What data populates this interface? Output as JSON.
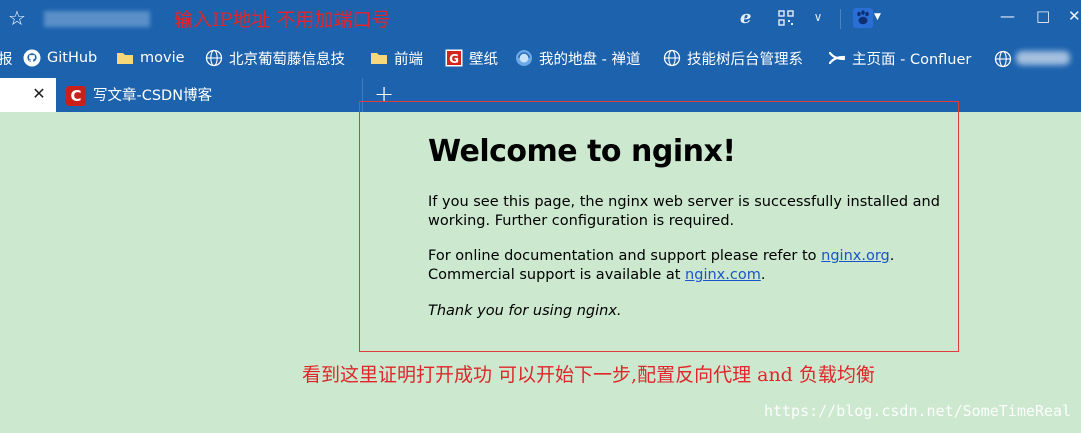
{
  "address_bar": {
    "annotation": "输入IP地址 不用加端口号",
    "icons": [
      "star-icon",
      "ie-icon",
      "qr-code-icon",
      "chevron-down-icon",
      "baidu-paw-icon"
    ]
  },
  "bookmarks": [
    {
      "label": "报",
      "icon": "none"
    },
    {
      "label": "GitHub",
      "icon": "github-icon"
    },
    {
      "label": "movie",
      "icon": "folder-icon"
    },
    {
      "label": "北京葡萄藤信息技",
      "icon": "globe-icon"
    },
    {
      "label": "前端",
      "icon": "folder-icon"
    },
    {
      "label": "壁纸",
      "icon": "wallpaper-g-icon"
    },
    {
      "label": "我的地盘 - 禅道",
      "icon": "zentao-icon"
    },
    {
      "label": "技能树后台管理系",
      "icon": "globe-icon"
    },
    {
      "label": "主页面 - Confluer",
      "icon": "confluence-icon"
    }
  ],
  "tabs": [
    {
      "label": "",
      "active": true
    },
    {
      "label": "写文章-CSDN博客",
      "active": false
    }
  ],
  "new_tab_label": "+",
  "close_label": "✕",
  "page": {
    "title": "Welcome to nginx!",
    "p1": "If you see this page, the nginx web server is successfully installed and working. Further configuration is required.",
    "p2_pre": "For online documentation and support please refer to ",
    "p2_link1": "nginx.org",
    "p2_mid": ".",
    "p2_line2_pre": "Commercial support is available at ",
    "p2_link2": "nginx.com",
    "p2_post": ".",
    "p3": "Thank you for using nginx."
  },
  "annotation_bottom": "看到这里证明打开成功 可以开始下一步,配置反向代理 and 负载均衡",
  "watermark": "https://blog.csdn.net/SomeTimeReal",
  "colors": {
    "chrome": "#1c62ad",
    "page_bg": "#cce8cf",
    "annotation": "#e0262a",
    "link": "#1a55c8"
  }
}
